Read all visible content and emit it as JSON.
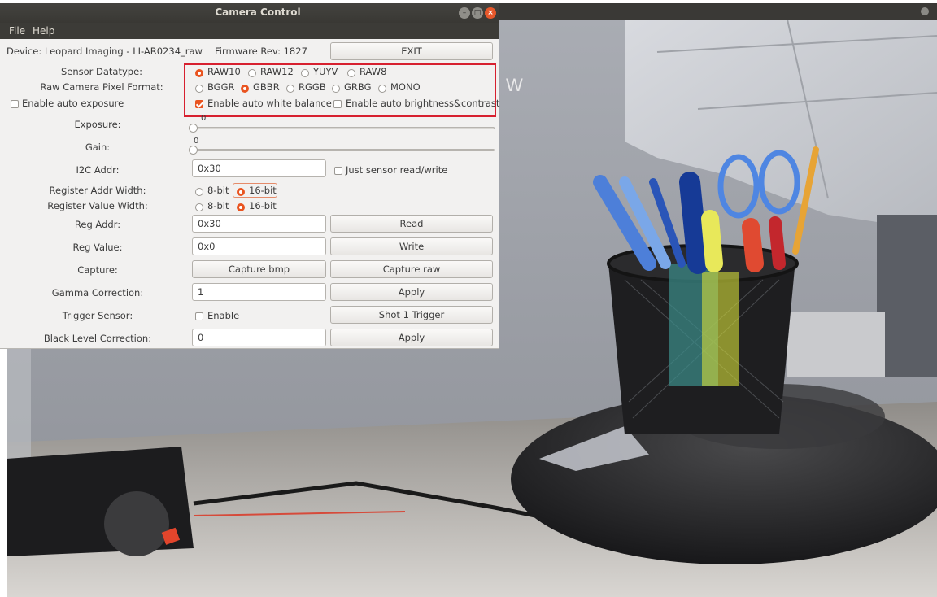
{
  "window": {
    "title": "Camera Control"
  },
  "menu": {
    "file": "File",
    "help": "Help"
  },
  "device": {
    "label": "Device: Leopard Imaging - LI-AR0234_raw",
    "firmware": "Firmware Rev: 1827",
    "exit_label": "EXIT"
  },
  "sensor_datatype": {
    "label": "Sensor Datatype:",
    "options": [
      "RAW10",
      "RAW12",
      "YUYV",
      "RAW8"
    ],
    "selected": "RAW10"
  },
  "pixel_format": {
    "label": "Raw Camera Pixel Format:",
    "options": [
      "BGGR",
      "GBBR",
      "RGGB",
      "GRBG",
      "MONO"
    ],
    "selected": "GBBR"
  },
  "auto_exposure": {
    "label": "Enable auto exposure",
    "checked": false
  },
  "auto_white_balance": {
    "label": "Enable auto white balance",
    "checked": true
  },
  "auto_brightness": {
    "label": "Enable auto brightness&contrast",
    "checked": false
  },
  "exposure": {
    "label": "Exposure:",
    "value": "0"
  },
  "gain": {
    "label": "Gain:",
    "value": "0"
  },
  "i2c": {
    "label": "I2C Addr:",
    "value": "0x30",
    "sensor_rw_label": "Just sensor read/write",
    "sensor_rw_checked": false
  },
  "reg_addr_width": {
    "label": "Register Addr Width:",
    "options": [
      "8-bit",
      "16-bit"
    ],
    "selected": "16-bit"
  },
  "reg_value_width": {
    "label": "Register Value Width:",
    "options": [
      "8-bit",
      "16-bit"
    ],
    "selected": "16-bit"
  },
  "reg_addr": {
    "label": "Reg Addr:",
    "value": "0x30",
    "button": "Read"
  },
  "reg_value": {
    "label": "Reg Value:",
    "value": "0x0",
    "button": "Write"
  },
  "capture": {
    "label": "Capture:",
    "bmp_button": "Capture bmp",
    "raw_button": "Capture raw"
  },
  "gamma": {
    "label": "Gamma Correction:",
    "value": "1",
    "button": "Apply"
  },
  "trigger": {
    "label": "Trigger Sensor:",
    "enable_label": "Enable",
    "enable_checked": false,
    "button": "Shot 1 Trigger"
  },
  "black_level": {
    "label": "Black Level Correction:",
    "value": "0",
    "button": "Apply"
  },
  "preview": {
    "overlay_text": "W"
  }
}
